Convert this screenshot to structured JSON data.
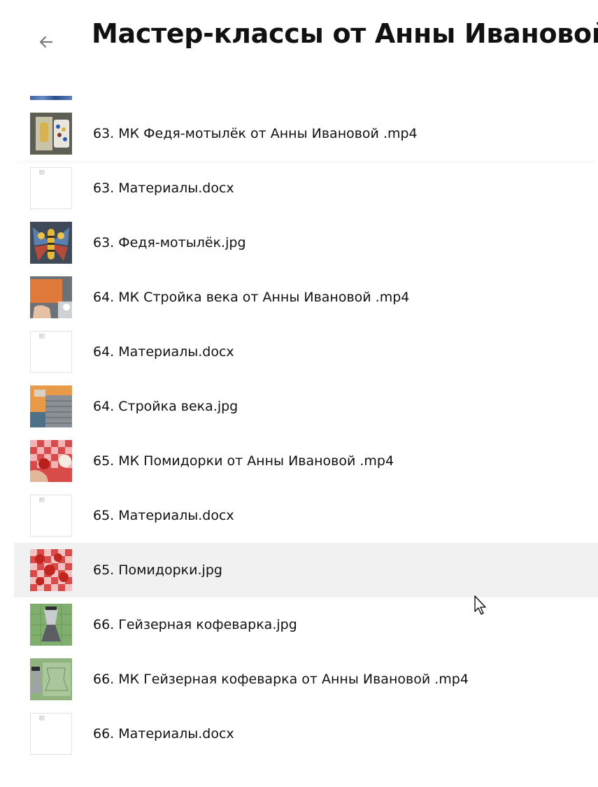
{
  "header": {
    "title": "Мастер-классы от Анны Ивановой",
    "back_icon": "arrow-left-icon"
  },
  "files": [
    {
      "name": "63. МК Федя-мотылёк от Анны Ивановой .mp4",
      "kind": "video"
    },
    {
      "name": "63. Материалы.docx",
      "kind": "doc"
    },
    {
      "name": "63. Федя-мотылёк.jpg",
      "kind": "image"
    },
    {
      "name": "64. МК Стройка века от Анны Ивановой .mp4",
      "kind": "video"
    },
    {
      "name": "64. Материалы.docx",
      "kind": "doc"
    },
    {
      "name": "64. Стройка века.jpg",
      "kind": "image"
    },
    {
      "name": "65. МК Помидорки от Анны Ивановой .mp4",
      "kind": "video"
    },
    {
      "name": "65. Материалы.docx",
      "kind": "doc"
    },
    {
      "name": "65. Помидорки.jpg",
      "kind": "image",
      "hovered": true
    },
    {
      "name": "66. Гейзерная кофеварка.jpg",
      "kind": "image"
    },
    {
      "name": "66. МК Гейзерная кофеварка от Анны Ивановой .mp4",
      "kind": "video"
    },
    {
      "name": "66. Материалы.docx",
      "kind": "doc"
    }
  ]
}
